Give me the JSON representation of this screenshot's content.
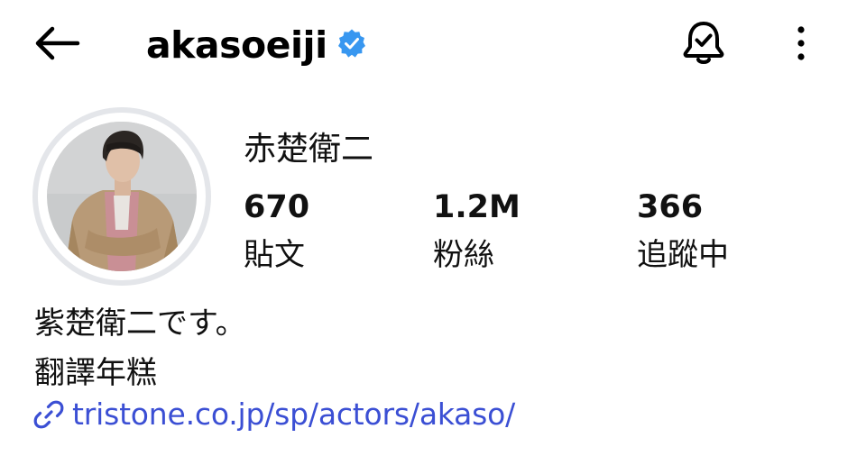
{
  "header": {
    "back_icon": "arrow-left-icon",
    "username": "akasoeiji",
    "verified_icon": "verified-badge-icon",
    "verified_color": "#3897f0",
    "notification_icon": "bell-check-icon",
    "more_icon": "more-vertical-icon"
  },
  "profile": {
    "display_name": "赤楚衛二",
    "avatar_icon": "profile-avatar",
    "stats": [
      {
        "value": "670",
        "label": "貼文"
      },
      {
        "value": "1.2M",
        "label": "粉絲"
      },
      {
        "value": "366",
        "label": "追蹤中"
      }
    ]
  },
  "bio": {
    "lines": [
      "紫楚衛二です。",
      "翻譯年糕"
    ],
    "link_icon": "link-icon",
    "link_text": "tristone.co.jp/sp/actors/akaso/",
    "link_color": "#3b4fd4"
  }
}
